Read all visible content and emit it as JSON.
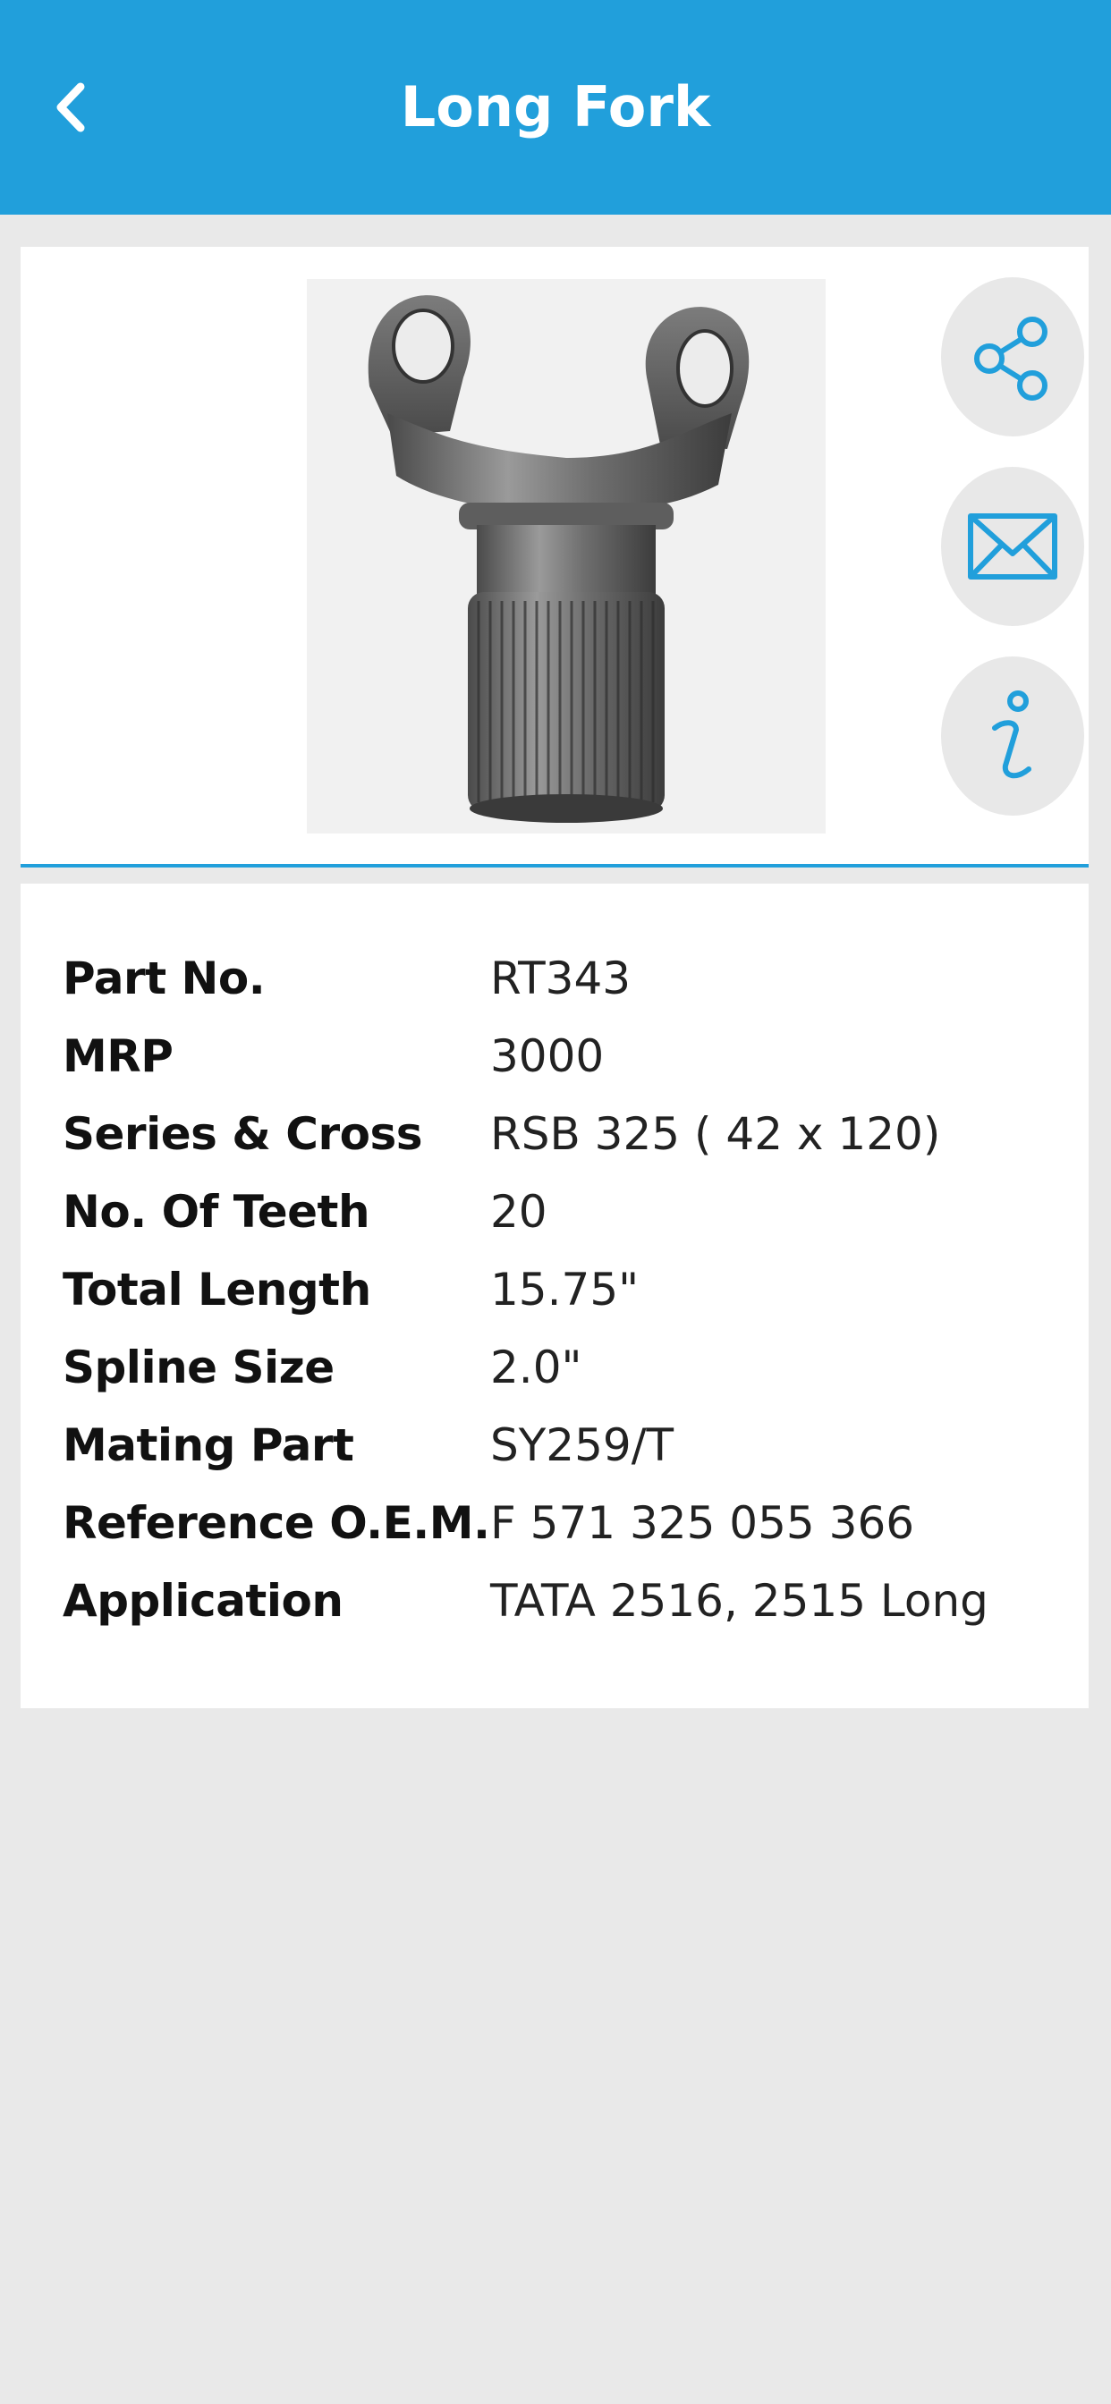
{
  "header": {
    "title": "Long Fork",
    "back_icon": "chevron-left-icon",
    "background_color": "#219fdb"
  },
  "product": {
    "image_alt": "Long fork yoke with splined shaft",
    "actions": {
      "share_icon": "share-icon",
      "mail_icon": "mail-icon",
      "info_icon": "info-icon"
    }
  },
  "details": [
    {
      "label": "Part No.",
      "value": "RT343"
    },
    {
      "label": "MRP",
      "value": "3000"
    },
    {
      "label": "Series & Cross",
      "value": "RSB 325 ( 42 x 120)"
    },
    {
      "label": "No. Of Teeth",
      "value": "20"
    },
    {
      "label": "Total Length",
      "value": "15.75\""
    },
    {
      "label": "Spline Size",
      "value": "2.0\""
    },
    {
      "label": "Mating Part",
      "value": "SY259/T"
    },
    {
      "label": "Reference O.E.M.",
      "value": "F 571 325 055 366"
    },
    {
      "label": "Application",
      "value": "TATA 2516, 2515 Long"
    }
  ]
}
